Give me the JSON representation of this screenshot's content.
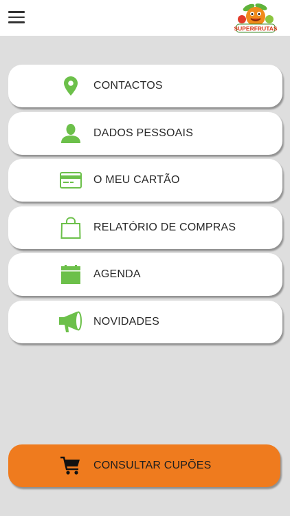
{
  "header": {
    "menu_icon": "hamburger-icon",
    "logo_text": "SUPERFRUTAS",
    "logo_icon": "orange-fruit-logo"
  },
  "colors": {
    "accent_green": "#6cc04a",
    "button_orange": "#ef7b1e",
    "background": "#dedede",
    "card": "#ffffff",
    "text": "#2a2a2a"
  },
  "menu": {
    "items": [
      {
        "label": "CONTACTOS",
        "icon": "map-pin-icon"
      },
      {
        "label": "DADOS PESSOAIS",
        "icon": "person-icon"
      },
      {
        "label": "O MEU CARTÃO",
        "icon": "credit-card-icon"
      },
      {
        "label": "RELATÓRIO DE COMPRAS",
        "icon": "shopping-bag-icon"
      },
      {
        "label": "AGENDA",
        "icon": "calendar-icon"
      },
      {
        "label": "NOVIDADES",
        "icon": "megaphone-icon"
      }
    ]
  },
  "coupon_button": {
    "label": "CONSULTAR CUPÕES",
    "icon": "shopping-cart-icon"
  }
}
